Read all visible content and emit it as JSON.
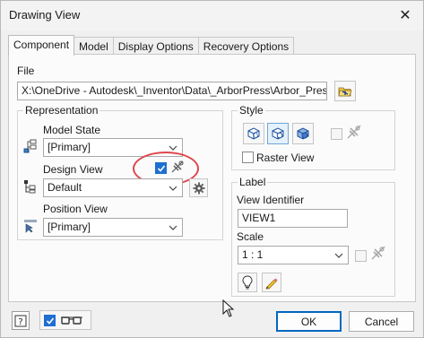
{
  "window": {
    "title": "Drawing View",
    "close_glyph": "✕"
  },
  "tabs": [
    {
      "label": "Component",
      "active": true
    },
    {
      "label": "Model"
    },
    {
      "label": "Display Options"
    },
    {
      "label": "Recovery Options"
    }
  ],
  "file": {
    "label": "File",
    "path": "X:\\OneDrive - Autodesk\\_Inventor\\Data\\_ArborPress\\Arbor_Press.",
    "browse_icon": "folder-open-icon"
  },
  "representation": {
    "title": "Representation",
    "model_state": {
      "label": "Model State",
      "value": "[Primary]",
      "icon": "model-state-icon"
    },
    "design_view": {
      "label": "Design View",
      "value": "Default",
      "icon": "design-view-icon",
      "associative_checked": true,
      "settings_icon": "gear-icon"
    },
    "position_view": {
      "label": "Position View",
      "value": "[Primary]",
      "icon": "position-view-icon"
    }
  },
  "style": {
    "title": "Style",
    "buttons": [
      "hidden-line-icon",
      "hidden-line-removed-icon",
      "shaded-icon"
    ],
    "raster_view_label": "Raster View"
  },
  "label": {
    "title": "Label",
    "view_identifier_label": "View Identifier",
    "view_identifier_value": "VIEW1",
    "scale_label": "Scale",
    "scale_value": "1 : 1"
  },
  "footer": {
    "help_icon": "help-icon",
    "ok_label": "OK",
    "cancel_label": "Cancel"
  },
  "colors": {
    "accent": "#0067c0",
    "highlight_circle": "#e0454b",
    "checkbox_blue": "#1e6fd0"
  }
}
